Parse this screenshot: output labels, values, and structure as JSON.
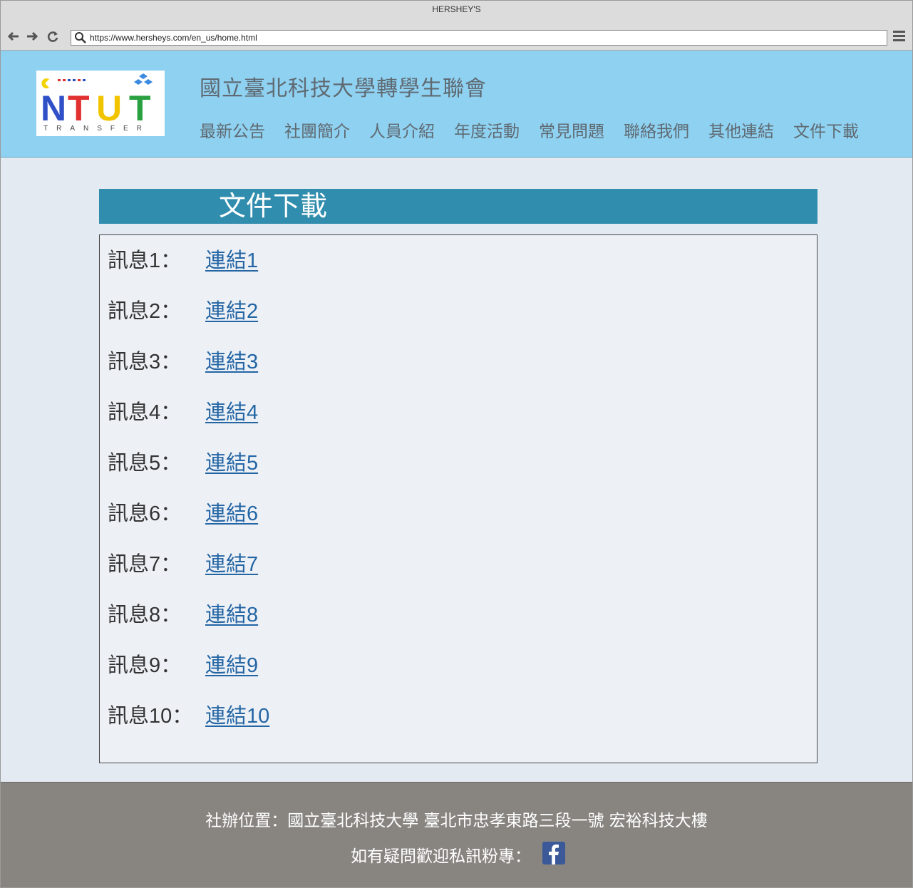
{
  "window": {
    "title": "HERSHEY'S"
  },
  "browser": {
    "url": "https://www.hersheys.com/en_us/home.html",
    "back_icon": "arrow-left-icon",
    "forward_icon": "arrow-right-icon",
    "reload_icon": "reload-icon",
    "menu_icon": "hamburger-menu-icon"
  },
  "header": {
    "logo_text": "NTUT",
    "logo_subtext": "TRANSFER",
    "site_title": "國立臺北科技大學轉學生聯會",
    "nav": [
      {
        "label": "最新公告"
      },
      {
        "label": "社團簡介"
      },
      {
        "label": "人員介紹"
      },
      {
        "label": "年度活動"
      },
      {
        "label": "常見問題"
      },
      {
        "label": "聯絡我們"
      },
      {
        "label": "其他連結"
      },
      {
        "label": "文件下載"
      }
    ]
  },
  "main": {
    "section_title": "文件下載",
    "items": [
      {
        "label": "訊息1：",
        "link": "連結1"
      },
      {
        "label": "訊息2：",
        "link": "連結2"
      },
      {
        "label": "訊息3：",
        "link": "連結3"
      },
      {
        "label": "訊息4：",
        "link": "連結4"
      },
      {
        "label": "訊息5：",
        "link": "連結5"
      },
      {
        "label": "訊息6：",
        "link": "連結6"
      },
      {
        "label": "訊息7：",
        "link": "連結7"
      },
      {
        "label": "訊息8：",
        "link": "連結8"
      },
      {
        "label": "訊息9：",
        "link": "連結9"
      },
      {
        "label": "訊息10：",
        "link": "連結10"
      }
    ]
  },
  "footer": {
    "address": "社辦位置：國立臺北科技大學  臺北市忠孝東路三段一號  宏裕科技大樓",
    "contact": "如有疑問歡迎私訊粉專：",
    "social_icon": "facebook-icon"
  },
  "colors": {
    "header_bg": "#8fd1f1",
    "section_head_bg": "#318dad",
    "link": "#2465a4",
    "footer_bg": "#888581"
  }
}
